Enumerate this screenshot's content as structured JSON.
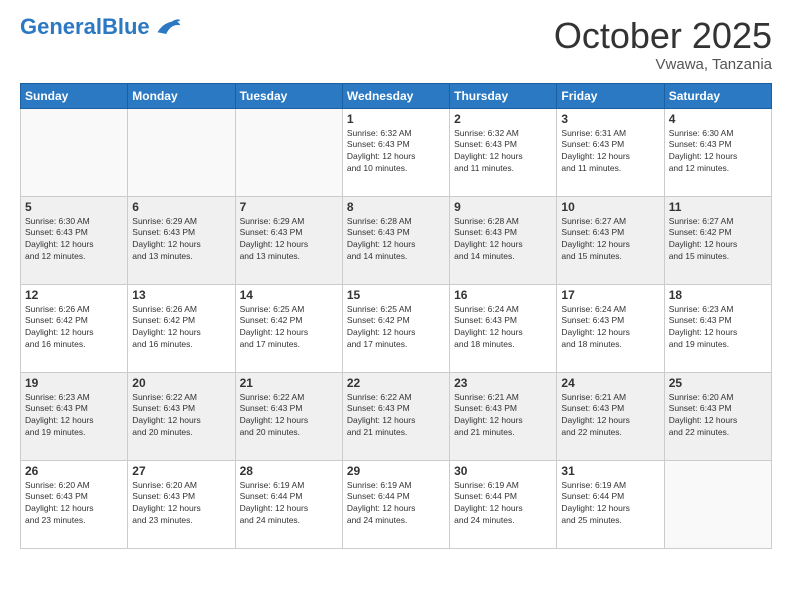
{
  "header": {
    "logo_general": "General",
    "logo_blue": "Blue",
    "month_title": "October 2025",
    "location": "Vwawa, Tanzania"
  },
  "days_of_week": [
    "Sunday",
    "Monday",
    "Tuesday",
    "Wednesday",
    "Thursday",
    "Friday",
    "Saturday"
  ],
  "weeks": [
    [
      {
        "day": "",
        "info": ""
      },
      {
        "day": "",
        "info": ""
      },
      {
        "day": "",
        "info": ""
      },
      {
        "day": "1",
        "info": "Sunrise: 6:32 AM\nSunset: 6:43 PM\nDaylight: 12 hours\nand 10 minutes."
      },
      {
        "day": "2",
        "info": "Sunrise: 6:32 AM\nSunset: 6:43 PM\nDaylight: 12 hours\nand 11 minutes."
      },
      {
        "day": "3",
        "info": "Sunrise: 6:31 AM\nSunset: 6:43 PM\nDaylight: 12 hours\nand 11 minutes."
      },
      {
        "day": "4",
        "info": "Sunrise: 6:30 AM\nSunset: 6:43 PM\nDaylight: 12 hours\nand 12 minutes."
      }
    ],
    [
      {
        "day": "5",
        "info": "Sunrise: 6:30 AM\nSunset: 6:43 PM\nDaylight: 12 hours\nand 12 minutes."
      },
      {
        "day": "6",
        "info": "Sunrise: 6:29 AM\nSunset: 6:43 PM\nDaylight: 12 hours\nand 13 minutes."
      },
      {
        "day": "7",
        "info": "Sunrise: 6:29 AM\nSunset: 6:43 PM\nDaylight: 12 hours\nand 13 minutes."
      },
      {
        "day": "8",
        "info": "Sunrise: 6:28 AM\nSunset: 6:43 PM\nDaylight: 12 hours\nand 14 minutes."
      },
      {
        "day": "9",
        "info": "Sunrise: 6:28 AM\nSunset: 6:43 PM\nDaylight: 12 hours\nand 14 minutes."
      },
      {
        "day": "10",
        "info": "Sunrise: 6:27 AM\nSunset: 6:43 PM\nDaylight: 12 hours\nand 15 minutes."
      },
      {
        "day": "11",
        "info": "Sunrise: 6:27 AM\nSunset: 6:42 PM\nDaylight: 12 hours\nand 15 minutes."
      }
    ],
    [
      {
        "day": "12",
        "info": "Sunrise: 6:26 AM\nSunset: 6:42 PM\nDaylight: 12 hours\nand 16 minutes."
      },
      {
        "day": "13",
        "info": "Sunrise: 6:26 AM\nSunset: 6:42 PM\nDaylight: 12 hours\nand 16 minutes."
      },
      {
        "day": "14",
        "info": "Sunrise: 6:25 AM\nSunset: 6:42 PM\nDaylight: 12 hours\nand 17 minutes."
      },
      {
        "day": "15",
        "info": "Sunrise: 6:25 AM\nSunset: 6:42 PM\nDaylight: 12 hours\nand 17 minutes."
      },
      {
        "day": "16",
        "info": "Sunrise: 6:24 AM\nSunset: 6:43 PM\nDaylight: 12 hours\nand 18 minutes."
      },
      {
        "day": "17",
        "info": "Sunrise: 6:24 AM\nSunset: 6:43 PM\nDaylight: 12 hours\nand 18 minutes."
      },
      {
        "day": "18",
        "info": "Sunrise: 6:23 AM\nSunset: 6:43 PM\nDaylight: 12 hours\nand 19 minutes."
      }
    ],
    [
      {
        "day": "19",
        "info": "Sunrise: 6:23 AM\nSunset: 6:43 PM\nDaylight: 12 hours\nand 19 minutes."
      },
      {
        "day": "20",
        "info": "Sunrise: 6:22 AM\nSunset: 6:43 PM\nDaylight: 12 hours\nand 20 minutes."
      },
      {
        "day": "21",
        "info": "Sunrise: 6:22 AM\nSunset: 6:43 PM\nDaylight: 12 hours\nand 20 minutes."
      },
      {
        "day": "22",
        "info": "Sunrise: 6:22 AM\nSunset: 6:43 PM\nDaylight: 12 hours\nand 21 minutes."
      },
      {
        "day": "23",
        "info": "Sunrise: 6:21 AM\nSunset: 6:43 PM\nDaylight: 12 hours\nand 21 minutes."
      },
      {
        "day": "24",
        "info": "Sunrise: 6:21 AM\nSunset: 6:43 PM\nDaylight: 12 hours\nand 22 minutes."
      },
      {
        "day": "25",
        "info": "Sunrise: 6:20 AM\nSunset: 6:43 PM\nDaylight: 12 hours\nand 22 minutes."
      }
    ],
    [
      {
        "day": "26",
        "info": "Sunrise: 6:20 AM\nSunset: 6:43 PM\nDaylight: 12 hours\nand 23 minutes."
      },
      {
        "day": "27",
        "info": "Sunrise: 6:20 AM\nSunset: 6:43 PM\nDaylight: 12 hours\nand 23 minutes."
      },
      {
        "day": "28",
        "info": "Sunrise: 6:19 AM\nSunset: 6:44 PM\nDaylight: 12 hours\nand 24 minutes."
      },
      {
        "day": "29",
        "info": "Sunrise: 6:19 AM\nSunset: 6:44 PM\nDaylight: 12 hours\nand 24 minutes."
      },
      {
        "day": "30",
        "info": "Sunrise: 6:19 AM\nSunset: 6:44 PM\nDaylight: 12 hours\nand 24 minutes."
      },
      {
        "day": "31",
        "info": "Sunrise: 6:19 AM\nSunset: 6:44 PM\nDaylight: 12 hours\nand 25 minutes."
      },
      {
        "day": "",
        "info": ""
      }
    ]
  ]
}
